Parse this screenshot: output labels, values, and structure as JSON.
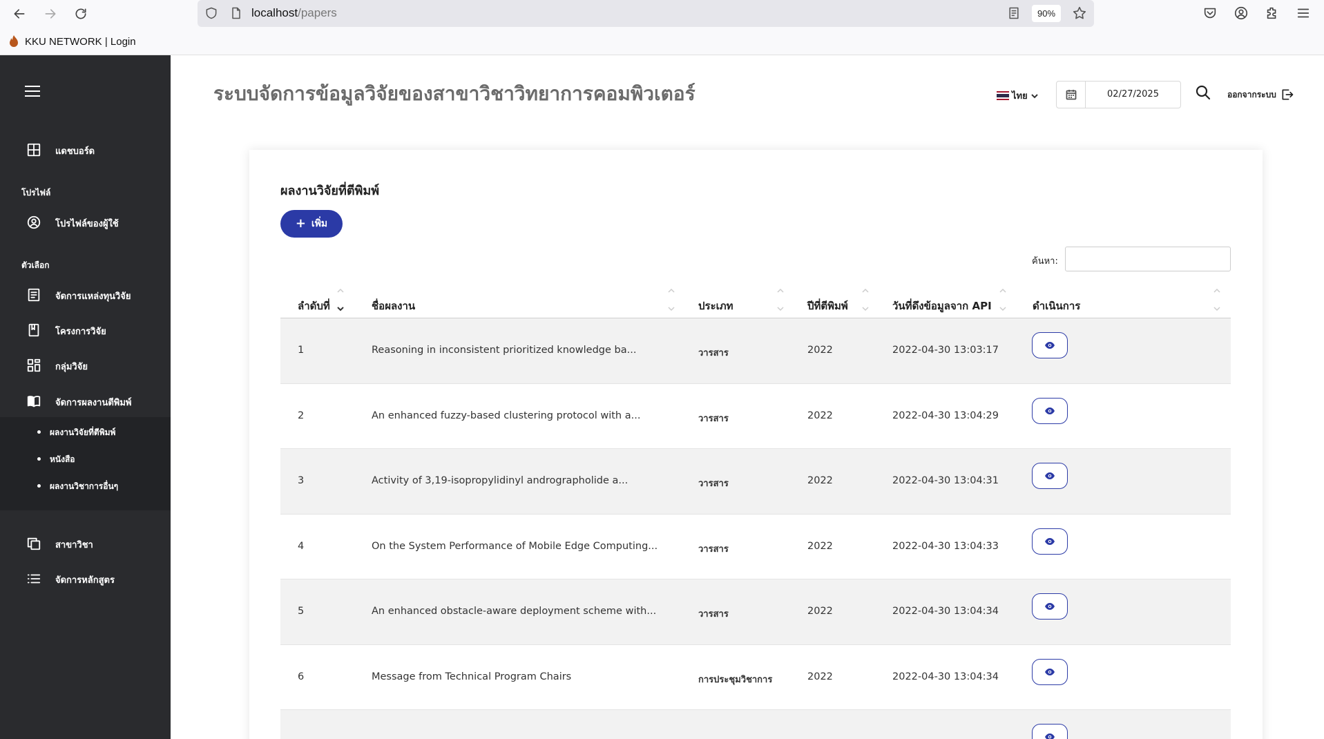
{
  "browser": {
    "url_host": "localhost",
    "url_path": "/papers",
    "zoom": "90%",
    "bookmark_label": "KKU NETWORK | Login"
  },
  "sidebar": {
    "dashboard": "แดชบอร์ด",
    "profile_heading": "โปรไฟล์",
    "user_profile": "โปรไฟล์ของผู้ใช้",
    "options_heading": "ตัวเลือก",
    "items": [
      {
        "label": "จัดการแหล่งทุนวิจัย",
        "icon": "document-list-icon"
      },
      {
        "label": "โครงการวิจัย",
        "icon": "bookmark-icon"
      },
      {
        "label": "กลุ่มวิจัย",
        "icon": "group-grid-icon"
      },
      {
        "label": "จัดการผลงานตีพิมพ์",
        "icon": "open-book-icon"
      }
    ],
    "submenu": [
      "ผลงานวิจัยที่ตีพิมพ์",
      "หนังสือ",
      "ผลงานวิชาการอื่นๆ"
    ],
    "bottom_items": [
      {
        "label": "สาขาวิชา",
        "icon": "copy-icon"
      },
      {
        "label": "จัดการหลักสูตร",
        "icon": "list-icon"
      }
    ]
  },
  "header": {
    "title": "ระบบจัดการข้อมูลวิจัยของสาขาวิชาวิทยาการคอมพิวเตอร์",
    "language": "ไทย",
    "date": "02/27/2025",
    "logout": "ออกจากระบบ"
  },
  "card": {
    "title": "ผลงานวิจัยที่ตีพิมพ์",
    "add_button": "เพิ่ม",
    "search_label": "ค้นหา:",
    "search_value": ""
  },
  "table": {
    "columns": [
      "ลำดับที่",
      "ชื่อผลงาน",
      "ประเภท",
      "ปีที่ตีพิมพ์",
      "วันที่ดึงข้อมูลจาก API",
      "ดำเนินการ"
    ],
    "rows": [
      {
        "no": "1",
        "title": "Reasoning in inconsistent prioritized knowledge ba...",
        "type": "วารสาร",
        "year": "2022",
        "fetched": "2022-04-30 13:03:17"
      },
      {
        "no": "2",
        "title": "An enhanced fuzzy-based clustering protocol with a...",
        "type": "วารสาร",
        "year": "2022",
        "fetched": "2022-04-30 13:04:29"
      },
      {
        "no": "3",
        "title": "Activity of 3,19-isopropylidinyl andrographolide a...",
        "type": "วารสาร",
        "year": "2022",
        "fetched": "2022-04-30 13:04:31"
      },
      {
        "no": "4",
        "title": "On the System Performance of Mobile Edge Computing...",
        "type": "วารสาร",
        "year": "2022",
        "fetched": "2022-04-30 13:04:33"
      },
      {
        "no": "5",
        "title": "An enhanced obstacle-aware deployment scheme with...",
        "type": "วารสาร",
        "year": "2022",
        "fetched": "2022-04-30 13:04:34"
      },
      {
        "no": "6",
        "title": "Message from Technical Program Chairs",
        "type": "การประชุมวิชาการ",
        "year": "2022",
        "fetched": "2022-04-30 13:04:34"
      }
    ]
  },
  "colors": {
    "sidebar_bg": "#2a2b2e",
    "submenu_bg": "#222326",
    "accent": "#2b3aa6",
    "row_stripe": "#f2f2f2"
  }
}
